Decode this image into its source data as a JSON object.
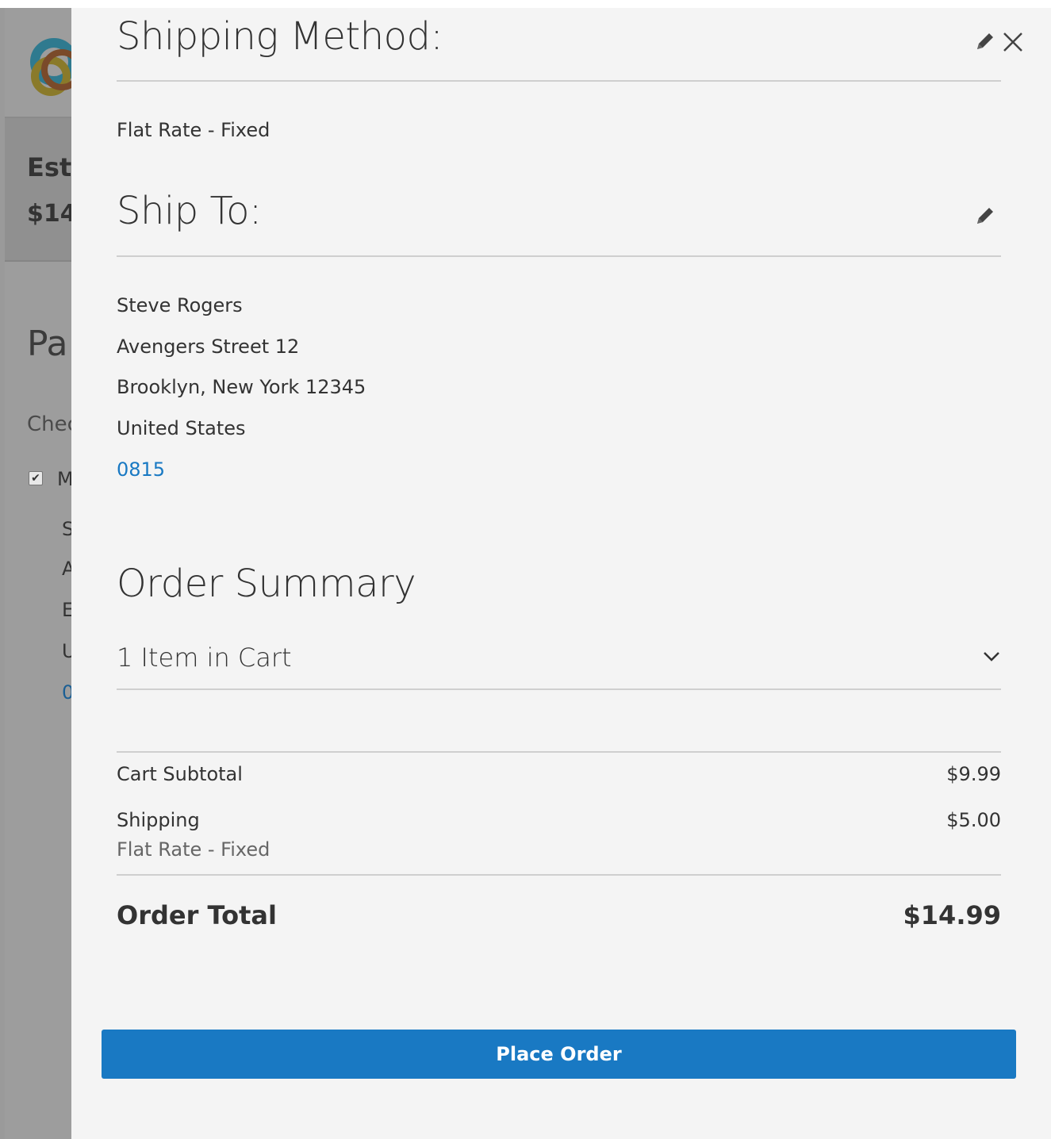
{
  "background": {
    "estimated_label_fragment": "Esti",
    "estimated_price_fragment": "$14",
    "payment_title_fragment": "Pa",
    "checkbox_label_fragment": "Chec",
    "checkbox_mark": "✔",
    "method_label_fragment": "M",
    "address_line_fragments": [
      "S",
      "A",
      "E",
      "U"
    ],
    "phone_fragment": "0"
  },
  "shipping_method": {
    "title": "Shipping Method:",
    "value": "Flat Rate - Fixed",
    "edit_icon": "pencil-icon",
    "close_icon": "close-icon"
  },
  "ship_to": {
    "title": "Ship To:",
    "edit_icon": "pencil-icon",
    "name": "Steve Rogers",
    "street": "Avengers Street 12",
    "city_line": "Brooklyn, New York 12345",
    "country": "United States",
    "phone": "0815"
  },
  "order_summary": {
    "title": "Order Summary",
    "items_in_cart": "1 Item in Cart",
    "toggle_icon": "chevron-down-icon",
    "cart_subtotal_label": "Cart Subtotal",
    "cart_subtotal_value": "$9.99",
    "shipping_label": "Shipping",
    "shipping_method": "Flat Rate - Fixed",
    "shipping_value": "$5.00",
    "order_total_label": "Order Total",
    "order_total_value": "$14.99"
  },
  "actions": {
    "place_order_label": "Place Order"
  },
  "colors": {
    "accent": "#1979c3",
    "panel_background": "#f4f4f4",
    "overlay_background": "#9d9d9d",
    "text": "#333333"
  }
}
